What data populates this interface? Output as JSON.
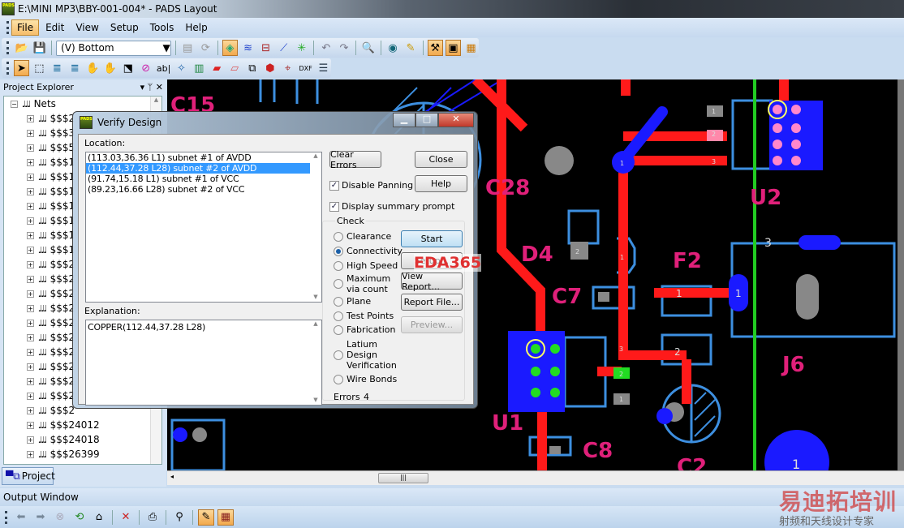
{
  "window": {
    "title": "E:\\MINI MP3\\BBY-001-004* - PADS Layout",
    "icon": "PADS"
  },
  "menu": [
    "File",
    "Edit",
    "View",
    "Setup",
    "Tools",
    "Help"
  ],
  "toolbar": {
    "layer_select": "(V) Bottom"
  },
  "project_explorer": {
    "title": "Project Explorer",
    "root": "Nets",
    "items": [
      "$$$2",
      "$$$3",
      "$$$5",
      "$$$1",
      "$$$1",
      "$$$1",
      "$$$1",
      "$$$1",
      "$$$1",
      "$$$1",
      "$$$2",
      "$$$2",
      "$$$2",
      "$$$2",
      "$$$2",
      "$$$2",
      "$$$2",
      "$$$2",
      "$$$2",
      "$$$2",
      "$$$2",
      "$$$24012",
      "$$$24018",
      "$$$26399"
    ],
    "tab": "Project"
  },
  "pcb": {
    "labels": [
      "C15",
      "C28",
      "D4",
      "C7",
      "F2",
      "U2",
      "J6",
      "U1",
      "C8",
      "C2"
    ],
    "pins": [
      "1",
      "2",
      "3",
      "1",
      "2",
      "3",
      "1",
      "2",
      "1",
      "1",
      "3",
      "1",
      "2",
      "1"
    ],
    "colors": {
      "top": "#ff1a1a",
      "bottom": "#1a1aff",
      "outline": "#3d8fe0",
      "silk": "#e0207a",
      "board": "#22cc22"
    }
  },
  "dialog": {
    "title": "Verify Design",
    "location_label": "Location:",
    "locations": [
      "(113.03,36.36 L1) subnet #1 of AVDD",
      "(112.44,37.28 L28) subnet #2 of AVDD",
      "(91.74,15.18 L1) subnet #1 of VCC",
      "(89.23,16.66 L28) subnet #2 of VCC"
    ],
    "selected_index": 1,
    "explanation_label": "Explanation:",
    "explanation": "COPPER(112.44,37.28 L28)",
    "buttons": {
      "clear_errors": "Clear Errors",
      "close": "Close",
      "help": "Help",
      "start": "Start",
      "setup": "Setup...",
      "view_report": "View Report...",
      "report_file": "Report File...",
      "preview": "Preview..."
    },
    "disable_panning": "Disable Panning",
    "display_summary": "Display summary prompt",
    "check_label": "Check",
    "checks": [
      "Clearance",
      "Connectivity",
      "High Speed",
      "Maximum via count",
      "Plane",
      "Test Points",
      "Fabrication",
      "Latium Design Verification",
      "Wire Bonds"
    ],
    "selected_check": "Connectivity",
    "errors_label": "Errors",
    "errors_count": "4"
  },
  "output_window": {
    "title": "Output Window"
  },
  "watermarks": {
    "eda": "EDA365",
    "cn_title": "易迪拓培训",
    "cn_sub": "射频和天线设计专家"
  }
}
